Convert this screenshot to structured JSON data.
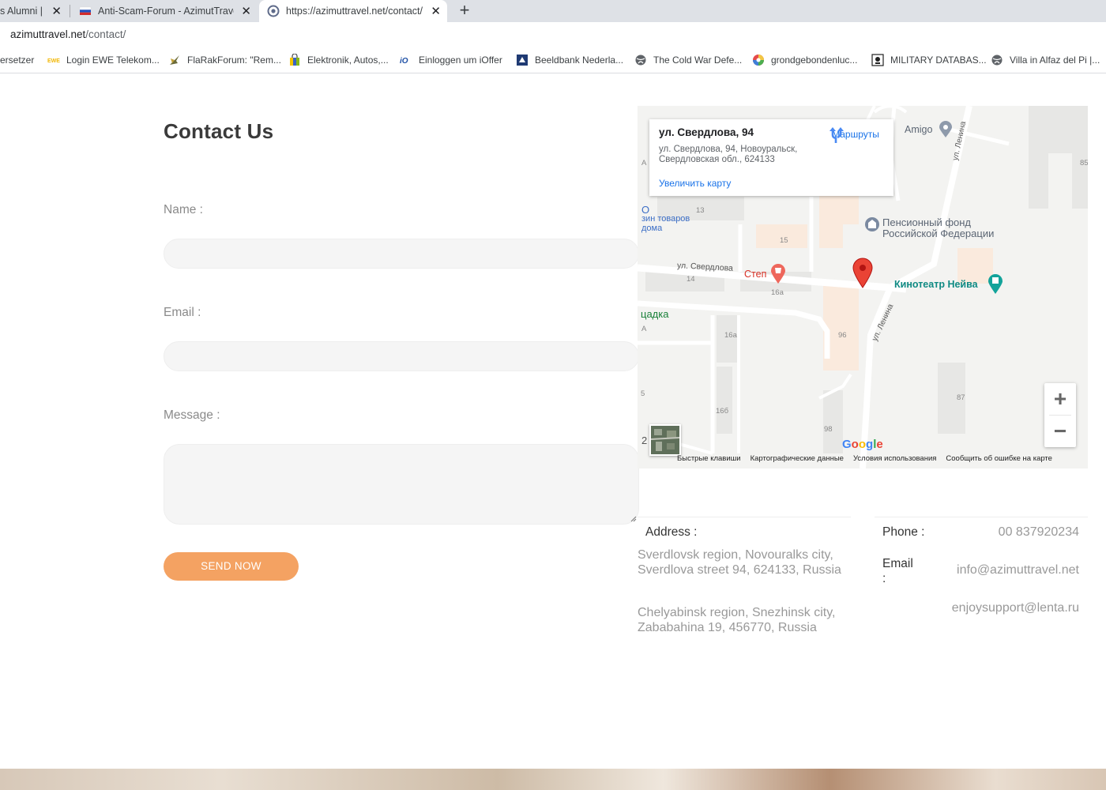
{
  "browser": {
    "tabs": [
      {
        "title": "s Alumni | F"
      },
      {
        "title": "Anti-Scam-Forum - AzimutTravel"
      },
      {
        "title": "https://azimuttravel.net/contact/"
      }
    ],
    "url_host": "azimuttravel.net",
    "url_path": "/contact/",
    "bookmarks": [
      {
        "label": "ersetzer"
      },
      {
        "label": "Login EWE Telekom..."
      },
      {
        "label": "FlaRakForum: \"Rem..."
      },
      {
        "label": "Elektronik, Autos,..."
      },
      {
        "label": "Einloggen um iOffer"
      },
      {
        "label": "Beeldbank Nederla..."
      },
      {
        "label": "The Cold War Defe..."
      },
      {
        "label": "grondgebondenluc..."
      },
      {
        "label": "MILITARY DATABAS..."
      },
      {
        "label": "Villa in Alfaz del Pi |..."
      }
    ]
  },
  "contact": {
    "title": "Contact Us",
    "name_label": "Name :",
    "email_label": "Email :",
    "message_label": "Message :",
    "send_label": "SEND NOW"
  },
  "map": {
    "card_title": "ул. Свердлова, 94",
    "card_address": "ул. Свердлова, 94, Новоуральск, Свердловская обл., 624133",
    "card_zoom": "Увеличить карту",
    "card_route": "Маршруты",
    "labels": {
      "amigo": "Amigo",
      "pension": "Пенсионный фонд Российской Федерации",
      "cinema": "Кинотеатр Нейва",
      "step": "Степ",
      "street_sverdlova": "ул. Свердлова",
      "street_lenina_top": "ул. Ленина",
      "street_lenina_mid": "ул. Ленина",
      "shop": "зин товаров",
      "shop2": "дома",
      "o_letter": "О",
      "playground": "цадка",
      "n13": "13",
      "n15": "15",
      "n14": "14",
      "n16a": "16а",
      "n16a2": "16а",
      "n96": "96",
      "n166": "16б",
      "n98": "98",
      "n87": "87",
      "n85": "85",
      "a1": "А",
      "a2": "А",
      "five": "5",
      "two": "2"
    },
    "footer": [
      "Быстрые клавиши",
      "Картографические данные",
      "Условия использования",
      "Сообщить об ошибке на карте"
    ],
    "google": "Google",
    "zoom_in": "+",
    "zoom_out": "−"
  },
  "details": {
    "address_label": "Address :",
    "address1": "Sverdlovsk region, Novouralks city, Sverdlova street 94, 624133, Russia",
    "address2": "Chelyabinsk region, Snezhinsk city, Zababahina 19, 456770, Russia",
    "phone_label": "Phone :",
    "phone_value": "00 837920234",
    "email_label": "Email :",
    "email_value1": "info@azimuttravel.net",
    "email_value2": "enjoysupport@lenta.ru"
  },
  "colors": {
    "accent": "#f4a262",
    "pin": "#ea4335",
    "cinema": "#12a39a",
    "link": "#1a73e8"
  }
}
